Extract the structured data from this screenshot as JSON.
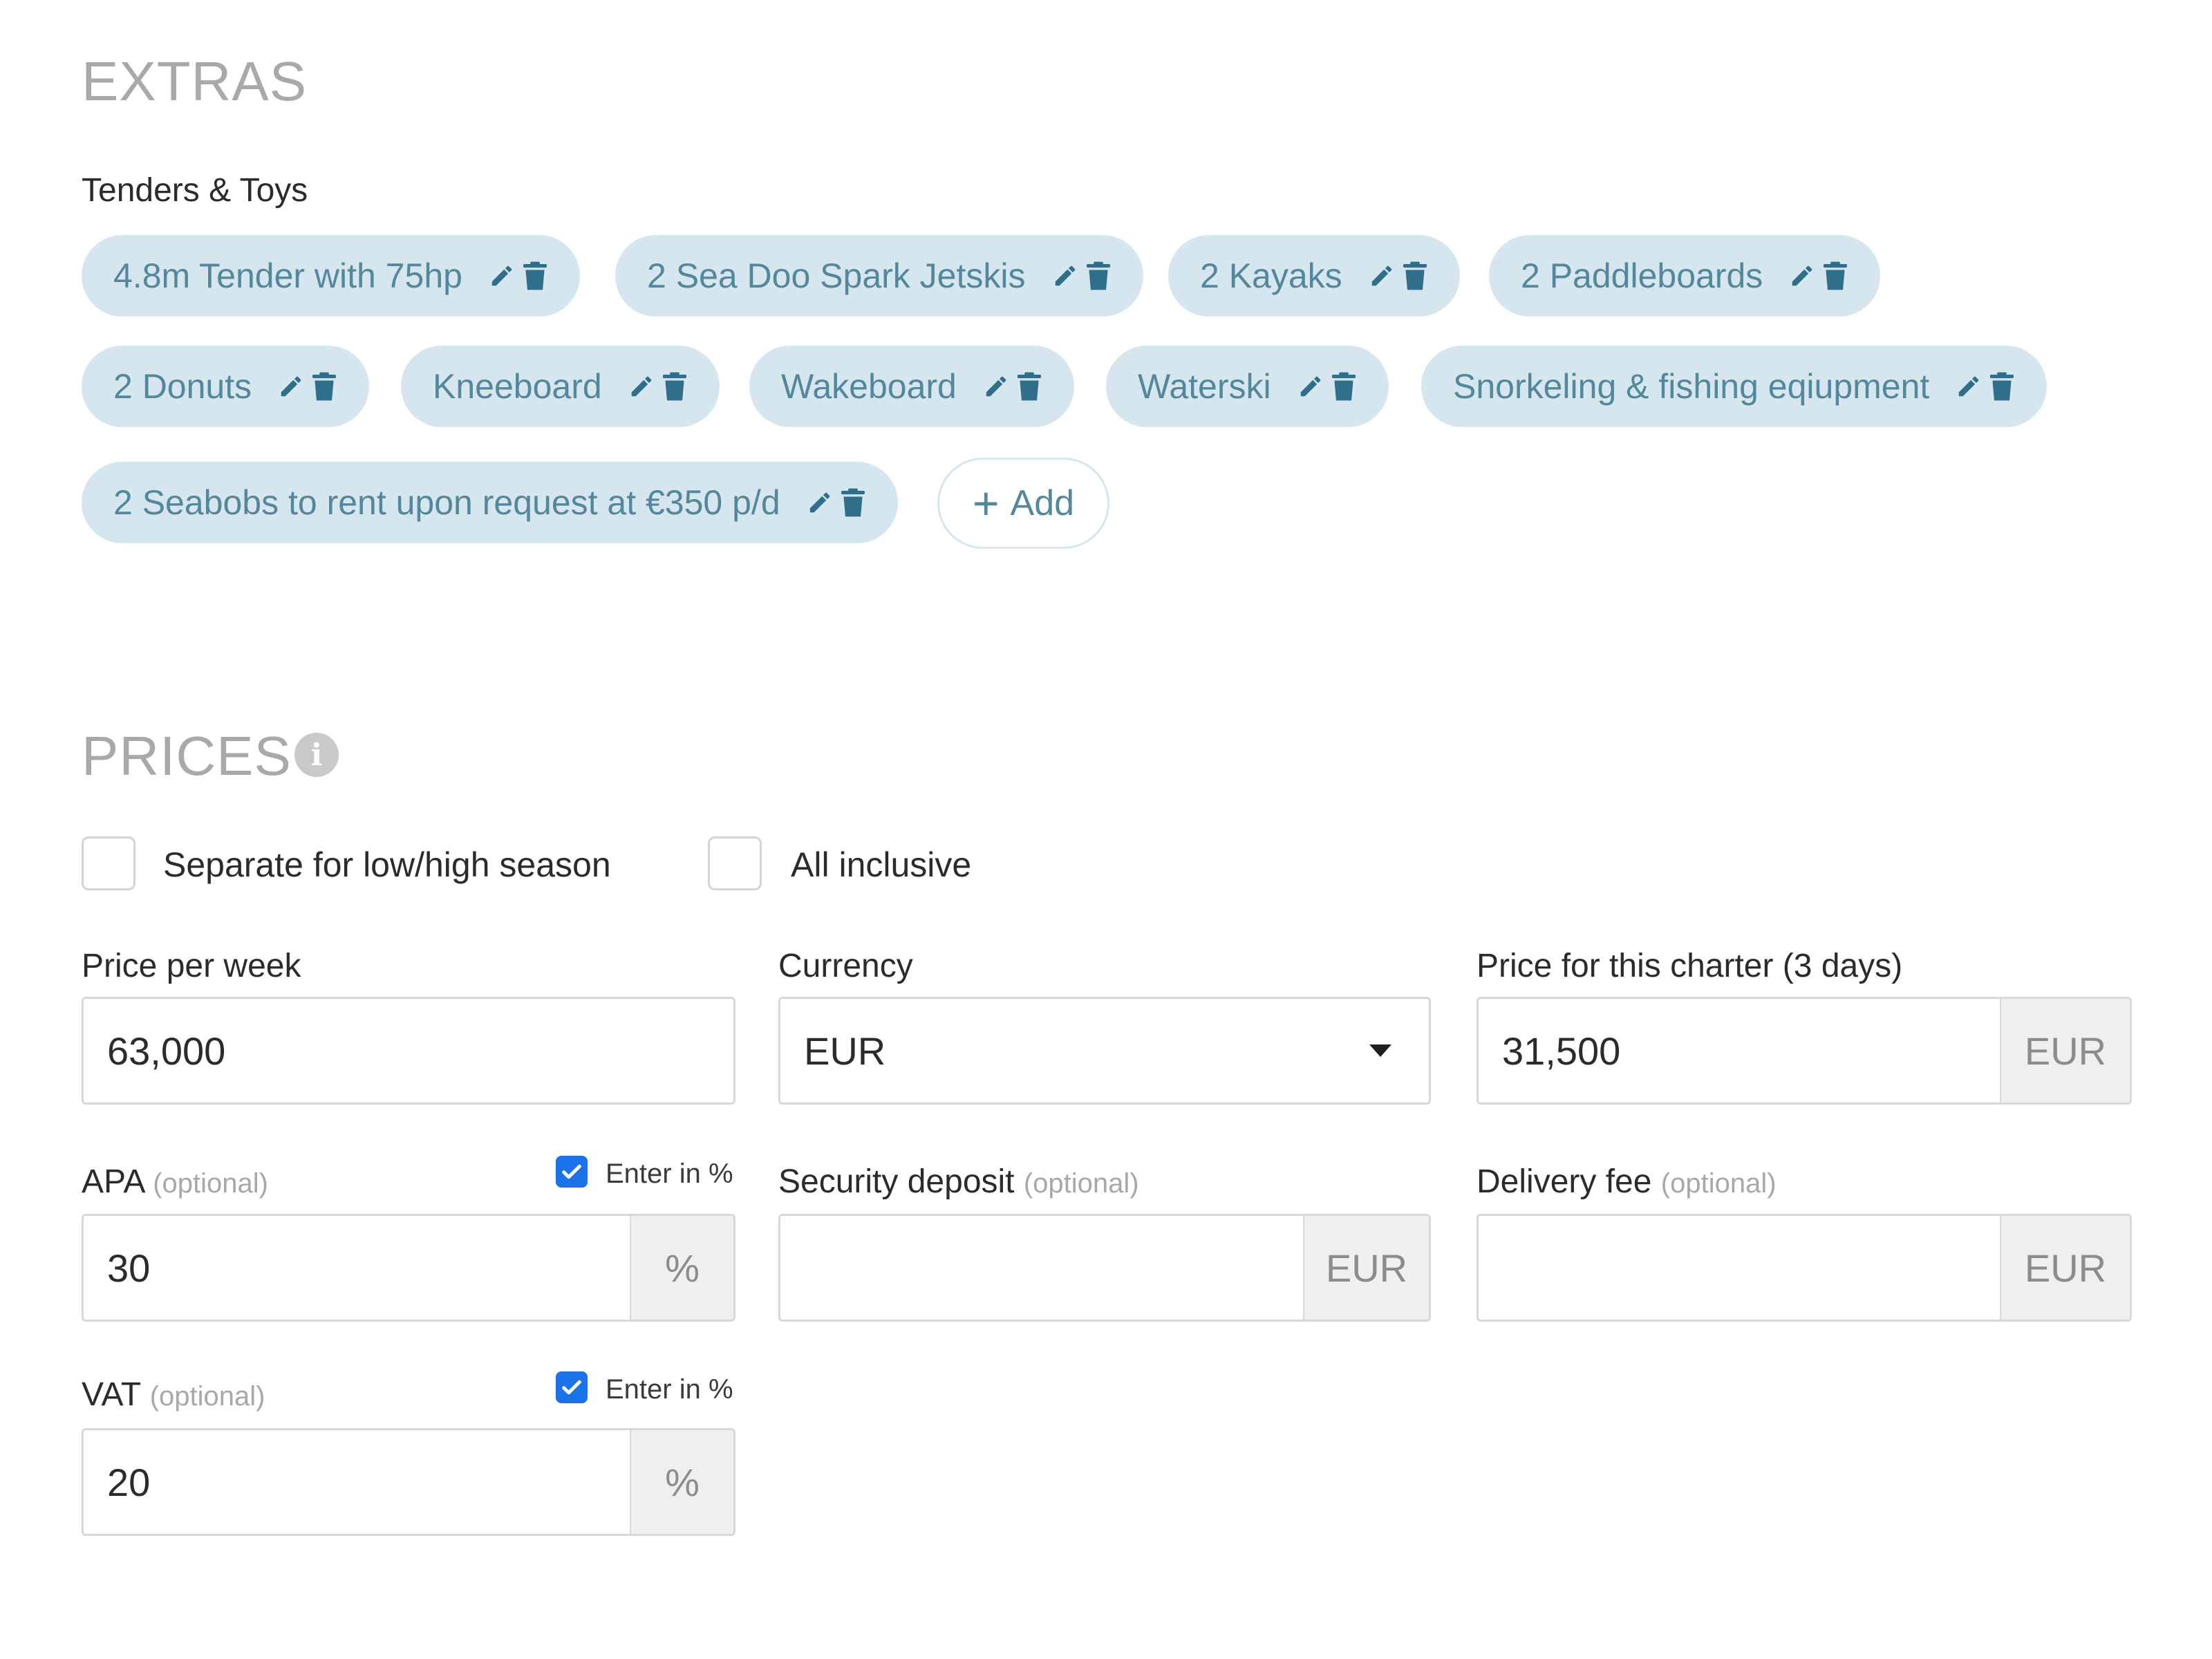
{
  "extras": {
    "title": "EXTRAS",
    "group_label": "Tenders & Toys",
    "tags": [
      "4.8m Tender with 75hp",
      "2 Sea Doo Spark Jetskis",
      "2 Kayaks",
      "2 Paddleboards",
      "2 Donuts",
      "Kneeboard",
      "Wakeboard",
      "Waterski",
      "Snorkeling & fishing eqiupment",
      "2 Seabobs to rent upon request at €350 p/d"
    ],
    "tag_icons": [
      "pencil-icon",
      "trash-icon"
    ],
    "add_label": "Add",
    "add_icon": "plus-icon"
  },
  "prices": {
    "title": "PRICES",
    "info_icon": "info-icon",
    "checkboxes": {
      "separate_season": {
        "label": "Separate for low/high season",
        "checked": false
      },
      "all_inclusive": {
        "label": "All inclusive",
        "checked": false
      }
    },
    "price_per_week": {
      "label": "Price per week",
      "value": "63,000"
    },
    "currency": {
      "label": "Currency",
      "selected": "EUR"
    },
    "charter_price": {
      "label": "Price for this charter (3 days)",
      "value": "31,500",
      "unit": "EUR"
    },
    "apa": {
      "label": "APA",
      "optional": "(optional)",
      "enter_in_percent_label": "Enter in %",
      "enter_in_percent_checked": true,
      "value": "30",
      "unit": "%"
    },
    "security_deposit": {
      "label": "Security deposit",
      "optional": "(optional)",
      "value": "",
      "unit": "EUR"
    },
    "delivery_fee": {
      "label": "Delivery fee",
      "optional": "(optional)",
      "value": "",
      "unit": "EUR"
    },
    "vat": {
      "label": "VAT",
      "optional": "(optional)",
      "enter_in_percent_label": "Enter in %",
      "enter_in_percent_checked": true,
      "value": "20",
      "unit": "%"
    }
  },
  "colors": {
    "chip_bg": "#d6e6ee",
    "chip_text": "#53879b",
    "section_title": "#a9a9a9",
    "checkbox_checked": "#1a73e8",
    "addon_bg": "#efefef"
  }
}
